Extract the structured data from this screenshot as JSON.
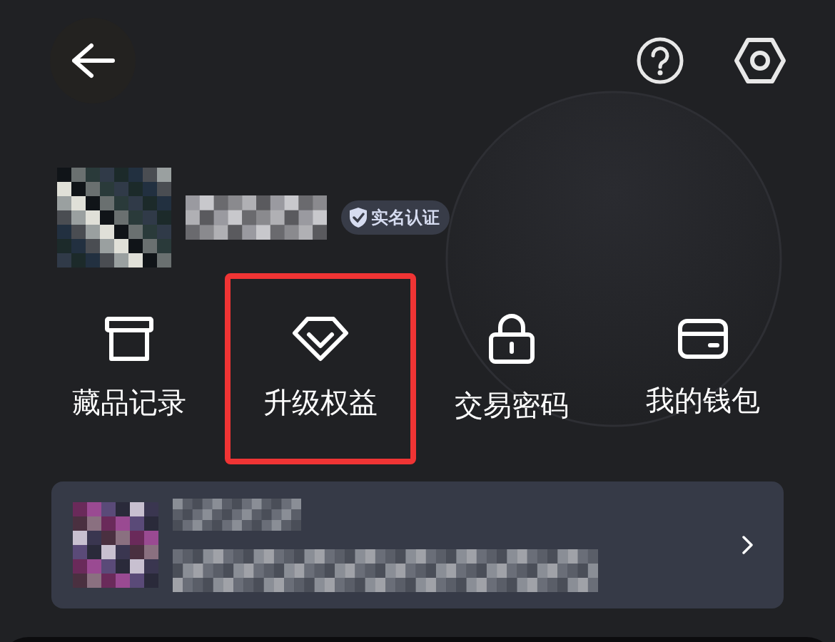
{
  "header": {
    "verified_badge": "实名认证"
  },
  "shortcuts": [
    {
      "label": "藏品记录",
      "kind": "archive",
      "highlighted": false
    },
    {
      "label": "升级权益",
      "kind": "diamond",
      "highlighted": true
    },
    {
      "label": "交易密码",
      "kind": "lock",
      "highlighted": false
    },
    {
      "label": "我的钱包",
      "kind": "wallet",
      "highlighted": false
    }
  ]
}
